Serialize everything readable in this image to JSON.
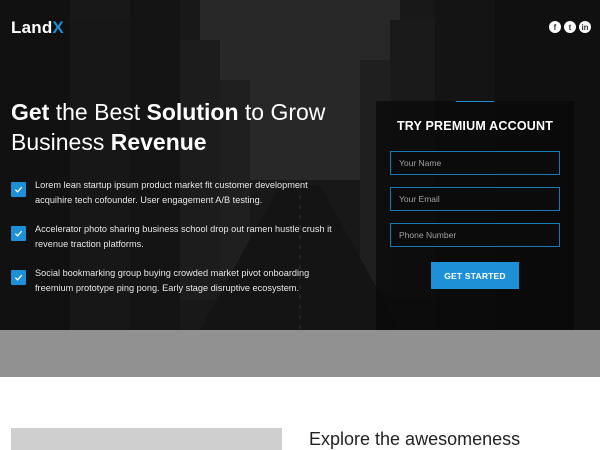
{
  "brand": {
    "logo_main": "Land",
    "logo_accent": "X",
    "accent_color": "#1e90d8"
  },
  "social": [
    {
      "icon": "facebook-icon",
      "glyph": "f"
    },
    {
      "icon": "twitter-icon",
      "glyph": "t"
    },
    {
      "icon": "linkedin-icon",
      "glyph": "in"
    }
  ],
  "hero": {
    "headline": {
      "w1": "Get",
      "w2": " the Best ",
      "w3": "Solution",
      "w4": " to Grow",
      "w5": "Business ",
      "w6": "Revenue"
    },
    "features": [
      "Lorem lean startup ipsum product market fit customer development acquihire tech cofounder. User engagement A/B testing.",
      "Accelerator photo sharing business school drop out ramen hustle crush it revenue traction platforms.",
      "Social bookmarking group buying crowded market pivot onboarding freemium prototype ping pong. Early stage disruptive ecosystem."
    ]
  },
  "form": {
    "title": "TRY PREMIUM ACCOUNT",
    "name_placeholder": "Your Name",
    "email_placeholder": "Your Email",
    "phone_placeholder": "Phone Number",
    "submit_label": "GET STARTED"
  },
  "section": {
    "title": "Explore the awesomeness"
  }
}
